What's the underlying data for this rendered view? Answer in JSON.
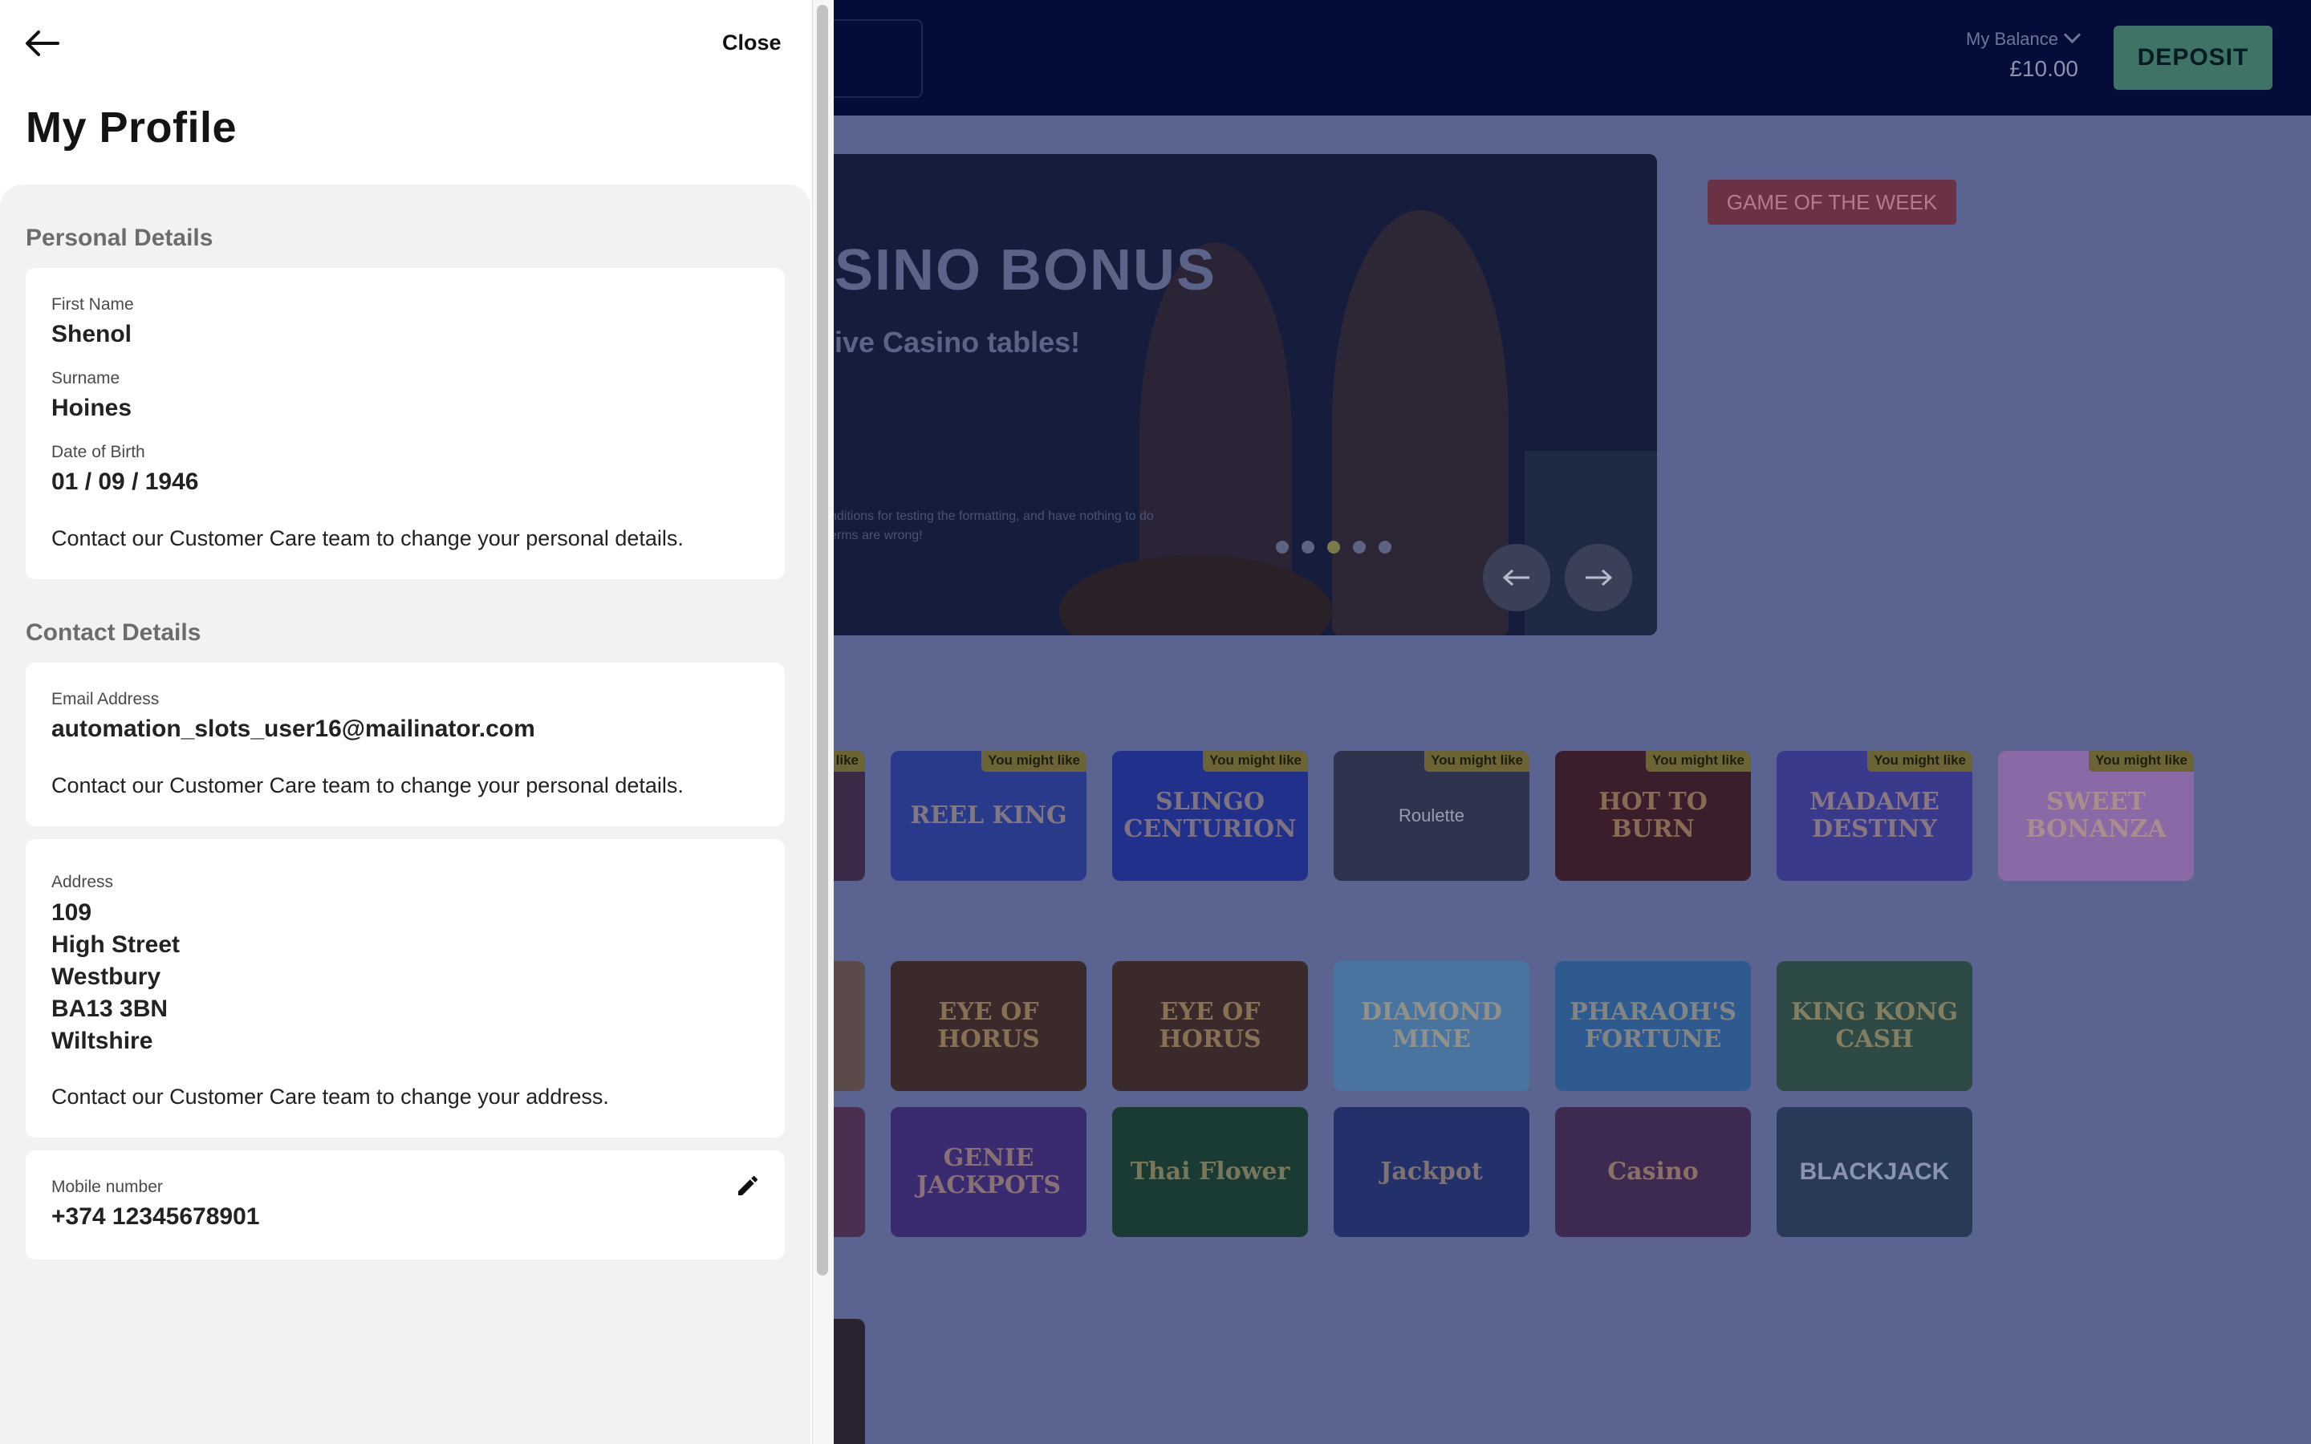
{
  "header": {
    "balance_label": "My Balance",
    "balance_value": "£10.00",
    "deposit_label": "DEPOSIT"
  },
  "hero": {
    "title": "SINO BONUS",
    "subtitle": "ive Casino tables!",
    "terms_line1": "nditions for testing the formatting, and have nothing to do",
    "terms_line2": "erms are wrong!",
    "slide_count": 5,
    "active_slide": 3
  },
  "game_of_the_week": "GAME OF THE WEEK",
  "games": {
    "tag_label": "You might like",
    "row1": [
      {
        "name": "",
        "tag": "like"
      },
      {
        "name": "REEL KING",
        "tag": "You might like"
      },
      {
        "name": "SLINGO CENTURION",
        "tag": "You might like"
      },
      {
        "name": "Roulette",
        "tag": "You might like"
      },
      {
        "name": "HOT TO BURN",
        "tag": "You might like"
      },
      {
        "name": "MADAME DESTINY",
        "tag": "You might like"
      },
      {
        "name": "SWEET BONANZA",
        "tag": "You might like"
      }
    ],
    "row2": [
      "",
      "EYE OF HORUS",
      "EYE OF HORUS",
      "DIAMOND MINE",
      "PHARAOH'S FORTUNE",
      "KING KONG CASH"
    ],
    "row3": [
      "",
      "GENIE JACKPOTS",
      "Thai Flower",
      "Jackpot",
      "Casino",
      "BLACKJACK"
    ]
  },
  "panel": {
    "close_label": "Close",
    "title": "My Profile",
    "personal": {
      "heading": "Personal Details",
      "first_name_label": "First Name",
      "first_name": "Shenol",
      "surname_label": "Surname",
      "surname": "Hoines",
      "dob_label": "Date of Birth",
      "dob": "01 / 09 / 1946",
      "note": "Contact our Customer Care team to change your personal details."
    },
    "contact": {
      "heading": "Contact Details",
      "email_label": "Email Address",
      "email": "automation_slots_user16@mailinator.com",
      "email_note": "Contact our Customer Care team to change your personal details.",
      "address_label": "Address",
      "address_lines": [
        "109",
        "High Street",
        "Westbury",
        "BA13 3BN",
        "Wiltshire"
      ],
      "address_note": "Contact our Customer Care team to change your address.",
      "mobile_label": "Mobile number",
      "mobile": "+374 12345678901"
    }
  },
  "colors": {
    "overlay_bg": "#5b6490",
    "topbar": "#040d39",
    "deposit": "#3f7366",
    "panel_body": "#f2f2f2"
  },
  "icons": {
    "back": "arrow-left-icon",
    "edit": "pencil-icon",
    "balance_toggle": "chevron-down-icon"
  }
}
